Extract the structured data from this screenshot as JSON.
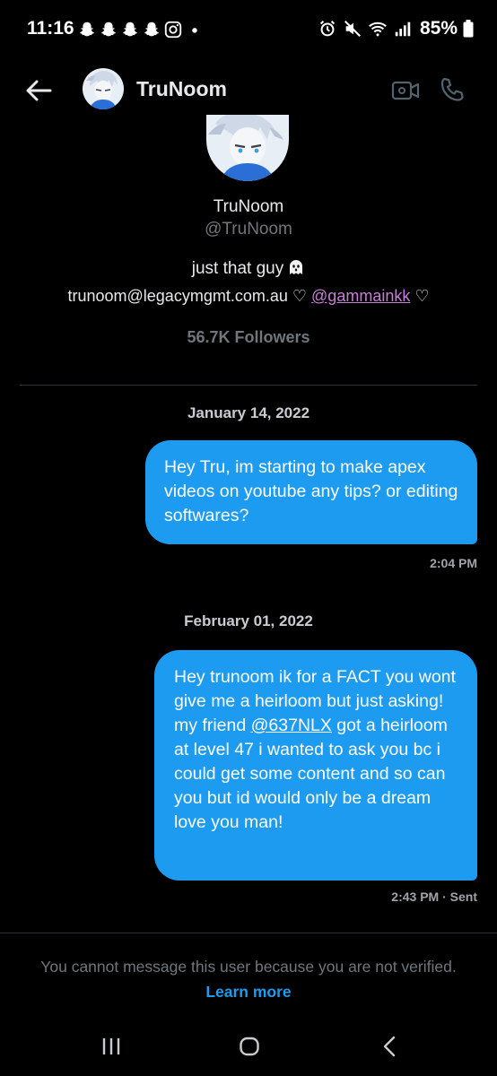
{
  "status_bar": {
    "time": "11:16",
    "notification_icons": [
      "snapchat-icon",
      "snapchat-icon",
      "snapchat-icon",
      "snapchat-icon",
      "instagram-icon",
      "dot-icon"
    ],
    "system_icons": [
      "alarm-icon",
      "mute-icon",
      "wifi-icon",
      "signal-icon"
    ],
    "battery_percent": "85%"
  },
  "header": {
    "title": "TruNoom",
    "icons": [
      "back-arrow-icon",
      "video-call-icon",
      "phone-icon"
    ]
  },
  "profile": {
    "name": "TruNoom",
    "handle": "@TruNoom",
    "bio": "just that guy",
    "bio_emoji": "ghost-emoji",
    "contact_email": "trunoom@legacymgmt.com.au",
    "heart_1": "♡",
    "mention": "@gammainkk",
    "heart_2": "♡",
    "followers": "56.7K Followers"
  },
  "conversation": [
    {
      "date": "January 14, 2022",
      "message": "Hey Tru, im starting to make apex videos on youtube any tips? or editing softwares?",
      "time": "2:04 PM"
    },
    {
      "date": "February 01, 2022",
      "message_before_mention": "Hey trunoom ik for a FACT you wont give me a heirloom but just asking! my friend ",
      "mention": "@637NLX",
      "message_after_mention": " got a heirloom at level 47 i wanted to ask you bc i could get some content and so can you but id would only be a dream love you man!",
      "time": "2:43 PM · Sent"
    }
  ],
  "footer": {
    "notice": "You cannot message this user because you are not verified. ",
    "learn_more": "Learn more"
  },
  "nav_bar": {
    "icons": [
      "recents-icon",
      "home-icon",
      "back-icon"
    ]
  },
  "colors": {
    "background": "#000000",
    "bubble": "#1d9bf0",
    "link": "#1d9bf0",
    "mention_profile": "#c87fd8",
    "secondary_text": "#71767b"
  }
}
